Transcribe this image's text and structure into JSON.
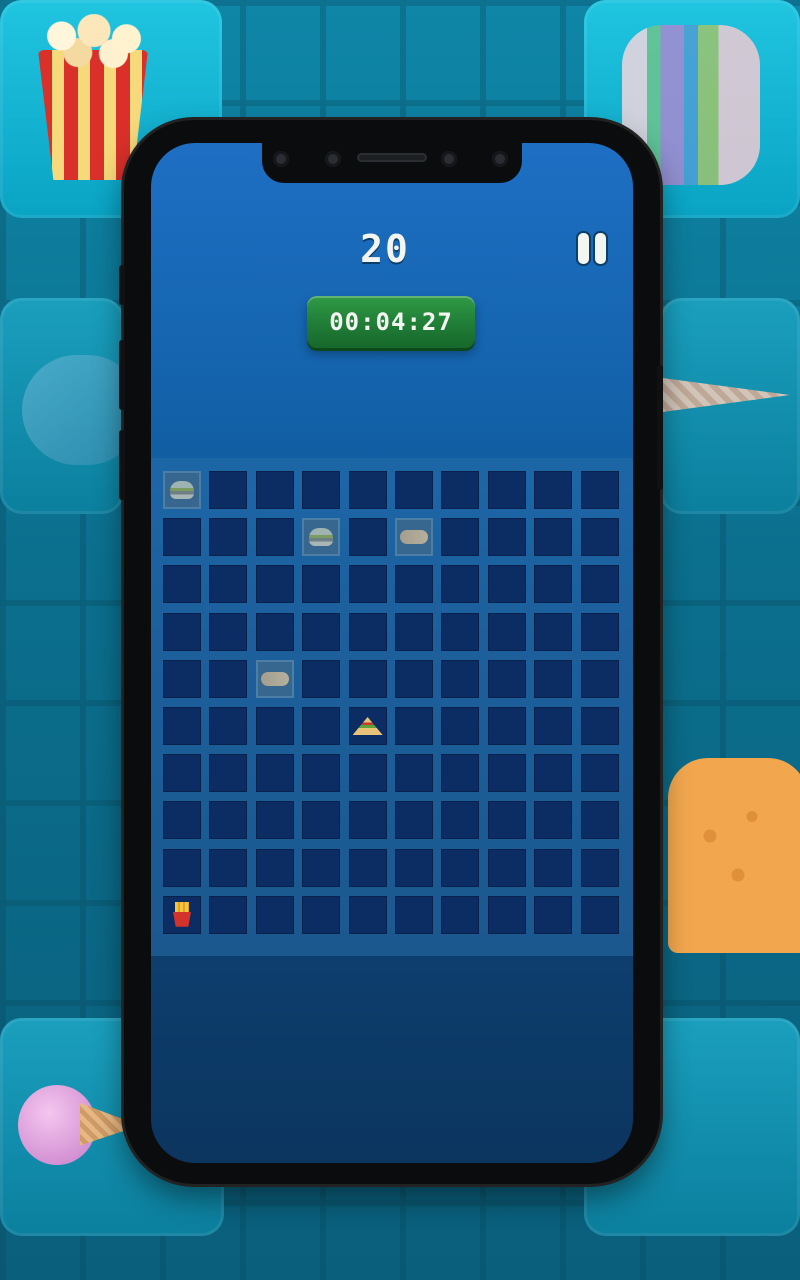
{
  "hud": {
    "score": "20",
    "timer": "00:04:27"
  },
  "board": {
    "rows": 10,
    "cols": 10,
    "revealed": [
      {
        "row": 0,
        "col": 0,
        "item": "burger-icon",
        "highlighted": true
      },
      {
        "row": 1,
        "col": 3,
        "item": "burger-icon",
        "highlighted": true
      },
      {
        "row": 1,
        "col": 5,
        "item": "shrimp-icon",
        "highlighted": true
      },
      {
        "row": 4,
        "col": 2,
        "item": "shrimp-icon",
        "highlighted": true
      },
      {
        "row": 5,
        "col": 4,
        "item": "sandwich-icon",
        "highlighted": false
      },
      {
        "row": 9,
        "col": 0,
        "item": "fries-icon",
        "highlighted": false
      }
    ]
  },
  "colors": {
    "hidden_tile": "#0c2c64",
    "revealed_tile": "#37678f",
    "timer_green": "#1f7a35",
    "text": "#f3f6f0"
  },
  "background_decor": [
    "popcorn-icon",
    "burger-icon",
    "hotdog-icon",
    "ice-cream-cone-icon",
    "toast-sandwich-icon",
    "ice-cream-icon"
  ]
}
